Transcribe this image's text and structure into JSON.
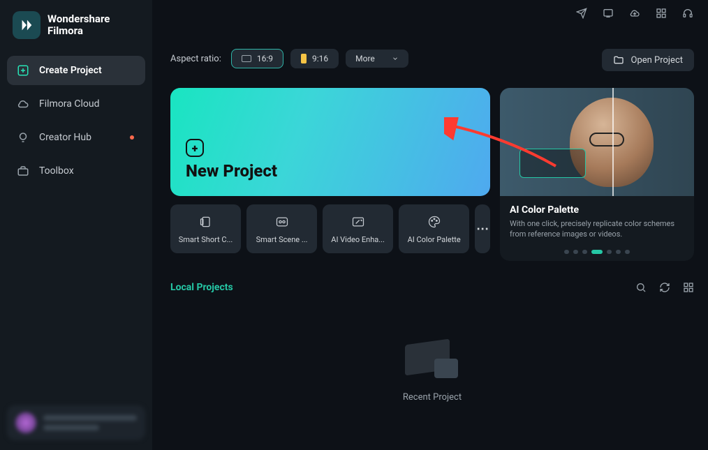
{
  "app": {
    "brand_line1": "Wondershare",
    "brand_line2": "Filmora"
  },
  "sidebar": {
    "items": [
      {
        "label": "Create Project"
      },
      {
        "label": "Filmora Cloud"
      },
      {
        "label": "Creator Hub"
      },
      {
        "label": "Toolbox"
      }
    ]
  },
  "options": {
    "aspect_label": "Aspect ratio:",
    "ratio_169": "16:9",
    "ratio_916": "9:16",
    "more": "More"
  },
  "open_project": "Open Project",
  "new_project": {
    "title": "New Project"
  },
  "tiles": [
    {
      "label": "Smart Short C..."
    },
    {
      "label": "Smart Scene ..."
    },
    {
      "label": "AI Video Enha..."
    },
    {
      "label": "AI Color Palette"
    }
  ],
  "promo": {
    "title": "AI Color Palette",
    "desc": "With one click, precisely replicate color schemes from reference images or videos."
  },
  "local": {
    "title": "Local Projects",
    "empty": "Recent Project"
  }
}
